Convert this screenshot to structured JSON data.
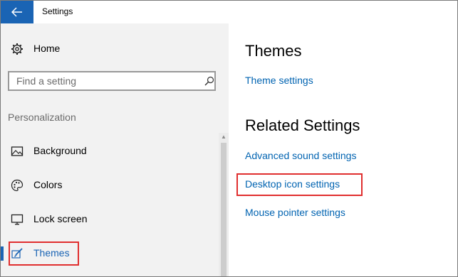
{
  "window": {
    "title": "Settings"
  },
  "sidebar": {
    "home_label": "Home",
    "search": {
      "placeholder": "Find a setting",
      "value": ""
    },
    "section_label": "Personalization",
    "items": [
      {
        "label": "Background",
        "icon": "image-icon"
      },
      {
        "label": "Colors",
        "icon": "palette-icon"
      },
      {
        "label": "Lock screen",
        "icon": "monitor-icon"
      },
      {
        "label": "Themes",
        "icon": "brush-icon",
        "selected": true
      }
    ]
  },
  "main": {
    "heading": "Themes",
    "theme_settings_link": "Theme settings",
    "related_heading": "Related Settings",
    "related_links": [
      "Advanced sound settings",
      "Desktop icon settings",
      "Mouse pointer settings"
    ]
  },
  "colors": {
    "accent": "#1a64b4",
    "link": "#0063b1",
    "highlight_box": "#e02e2e",
    "sidebar_bg": "#f2f2f2"
  }
}
